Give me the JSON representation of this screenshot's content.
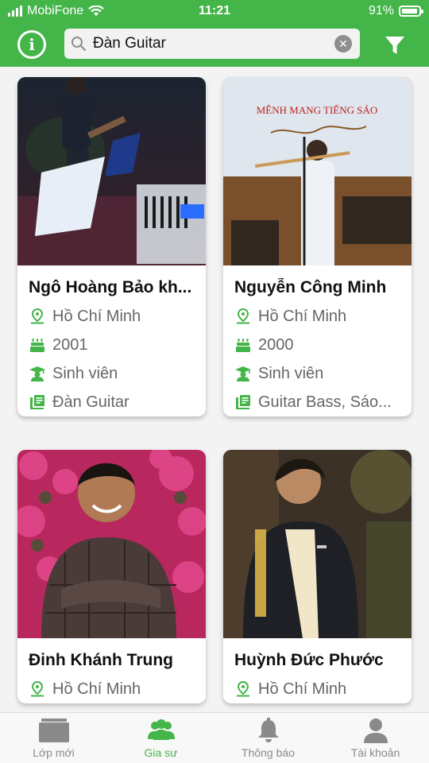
{
  "status": {
    "carrier": "MobiFone",
    "time": "11:21",
    "battery": "91%"
  },
  "search": {
    "query": "Đàn Guitar"
  },
  "colors": {
    "brand": "#44b549"
  },
  "tutors": [
    {
      "name": "Ngô Hoàng Bảo kh...",
      "city": "Hồ Chí Minh",
      "year": "2001",
      "job": "Sinh viên",
      "subjects": "Đàn Guitar"
    },
    {
      "name": "Nguyễn Công Minh",
      "city": "Hồ Chí Minh",
      "year": "2000",
      "job": "Sinh viên",
      "subjects": "Guitar Bass, Sáo..."
    },
    {
      "name": "Đinh Khánh Trung",
      "city": "Hồ Chí Minh"
    },
    {
      "name": "Huỳnh Đức Phước",
      "city": "Hồ Chí Minh"
    }
  ],
  "poster": {
    "title": "MÊNH MANG TIẾNG SÁO"
  },
  "tabs": [
    {
      "label": "Lớp mới",
      "icon": "classes-icon"
    },
    {
      "label": "Gia sư",
      "icon": "tutors-icon"
    },
    {
      "label": "Thông báo",
      "icon": "bell-icon"
    },
    {
      "label": "Tài khoản",
      "icon": "account-icon"
    }
  ]
}
